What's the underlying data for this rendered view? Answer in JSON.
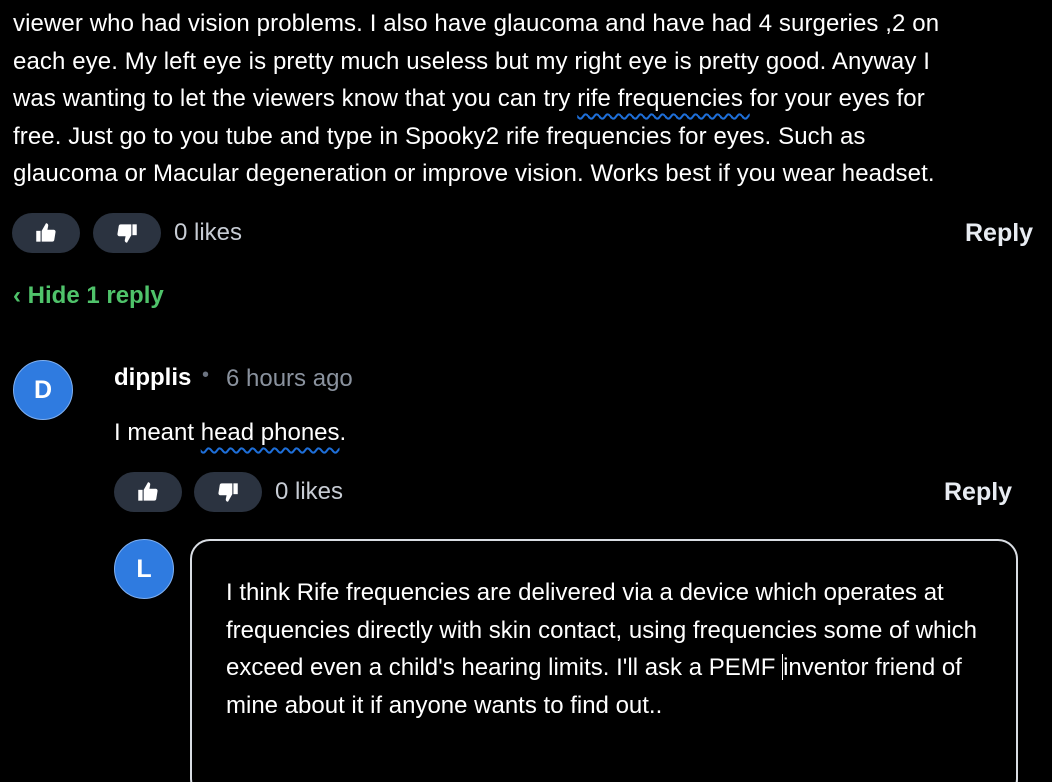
{
  "parent_comment": {
    "text_line1": "viewer who had vision problems. I also have glaucoma and have had 4 surgeries ,2 on",
    "text_line2": "each eye. My left eye is pretty much useless but my right eye is pretty good. Anyway I",
    "text_line3_pre": "was wanting to let the viewers know that you can try ",
    "text_line3_mis": "rife frequencies ",
    "text_line3_post": "for your eyes for",
    "text_line4": "free. Just go to you tube and type in Spooky2 rife frequencies for eyes. Such as",
    "text_line5": "glaucoma or Macular degeneration or improve vision. Works best if you wear headset.",
    "likes": "0 likes",
    "reply_label": "Reply"
  },
  "replies_toggle": "‹ Hide 1 reply",
  "reply": {
    "avatar_letter": "D",
    "username": "dipplis",
    "separator": "•",
    "timestamp": "6 hours ago",
    "text_pre": "I meant ",
    "text_mis": "head phones",
    "text_post": ".",
    "likes": "0 likes",
    "reply_label": "Reply"
  },
  "composer": {
    "avatar_letter": "L",
    "text_before_caret": "I think Rife frequencies are delivered via a device which operates at frequencies directly with skin contact, using frequencies some of which exceed even a child's hearing limits. I'll ask a PEMF ",
    "text_after_caret": "inventor friend of mine about it if anyone wants to find out.."
  },
  "icons": {
    "upvote": "thumbs-up-icon",
    "downvote": "thumbs-down-icon"
  },
  "colors": {
    "background": "#000000",
    "vote_button": "#2b3340",
    "hide_replies": "#4fc36a",
    "avatar": "#2f7be0",
    "spellcheck": "#1e6fd9"
  }
}
